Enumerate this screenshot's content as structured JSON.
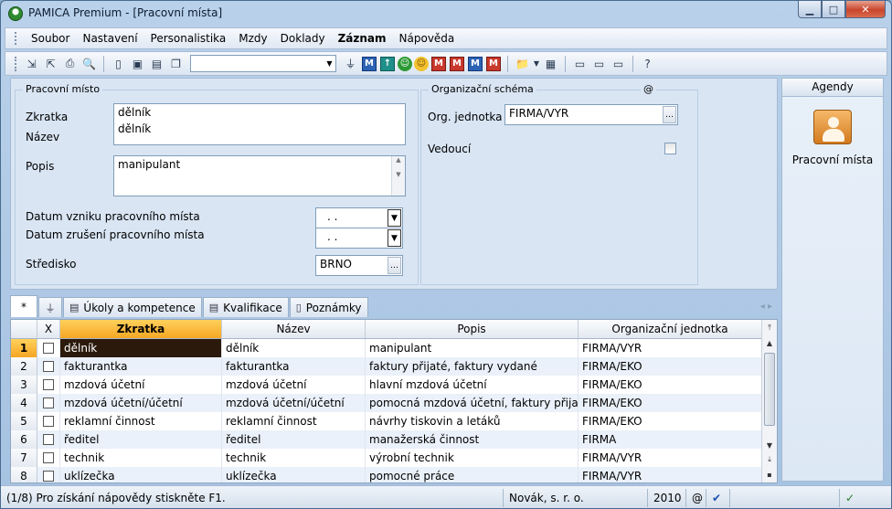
{
  "window": {
    "title": "PAMICA Premium - [Pracovní místa]",
    "minimize_glyph": "▁",
    "maximize_glyph": "□",
    "close_glyph": "✕"
  },
  "menu": [
    "Soubor",
    "Nastavení",
    "Personalistika",
    "Mzdy",
    "Doklady",
    "Záznam",
    "Nápověda"
  ],
  "toolbar": {
    "combo_value": "",
    "m_label": "M"
  },
  "form": {
    "group1_title": "Pracovní místo",
    "zkratka_label": "Zkratka",
    "zkratka_value": "dělník",
    "nazev_label": "Název",
    "nazev_value": "dělník",
    "popis_label": "Popis",
    "popis_value": "manipulant",
    "datum_vzniku_label": "Datum vzniku pracovního  místa",
    "datum_vzniku_value": ". .",
    "datum_zruseni_label": "Datum zrušení pracovního  místa",
    "datum_zruseni_value": ". .",
    "stredisko_label": "Středisko",
    "stredisko_value": "BRNO",
    "group2_title": "Organizační schéma",
    "group2_at": "@",
    "org_label": "Org. jednotka",
    "org_value": "FIRMA/VYR",
    "vedouci_label": "Vedoucí"
  },
  "agendy": {
    "header": "Agendy",
    "item_label": "Pracovní místa"
  },
  "tabs": {
    "star": "*",
    "items": [
      "Úkoly a kompetence",
      "Kvalifikace",
      "Poznámky"
    ]
  },
  "grid": {
    "columns": [
      "",
      "X",
      "Zkratka",
      "Název",
      "Popis",
      "Organizační jednotka"
    ],
    "rows": [
      {
        "num": "1",
        "zkratka": "dělník",
        "nazev": "dělník",
        "popis": "manipulant",
        "org": "FIRMA/VYR"
      },
      {
        "num": "2",
        "zkratka": "fakturantka",
        "nazev": "fakturantka",
        "popis": "faktury přijaté, faktury vydané",
        "org": "FIRMA/EKO"
      },
      {
        "num": "3",
        "zkratka": "mzdová účetní",
        "nazev": "mzdová účetní",
        "popis": "hlavní mzdová účetní",
        "org": "FIRMA/EKO"
      },
      {
        "num": "4",
        "zkratka": "mzdová účetní/účetní",
        "nazev": "mzdová účetní/účetní",
        "popis": "pomocná mzdová účetní, faktury přijaté",
        "org": "FIRMA/EKO"
      },
      {
        "num": "5",
        "zkratka": "reklamní činnost",
        "nazev": "reklamní činnost",
        "popis": "návrhy tiskovin a letáků",
        "org": "FIRMA/EKO"
      },
      {
        "num": "6",
        "zkratka": "ředitel",
        "nazev": "ředitel",
        "popis": "manažerská činnost",
        "org": "FIRMA"
      },
      {
        "num": "7",
        "zkratka": "technik",
        "nazev": "technik",
        "popis": "výrobní technik",
        "org": "FIRMA/VYR"
      },
      {
        "num": "8",
        "zkratka": "uklízečka",
        "nazev": "uklízečka",
        "popis": "pomocné práce",
        "org": "FIRMA/VYR"
      }
    ]
  },
  "status": {
    "help": "(1/8) Pro získání nápovědy stiskněte F1.",
    "company": "Novák, s. r. o.",
    "year": "2010",
    "at": "@"
  },
  "colors": {
    "accent": "#f5a623",
    "selected_cell": "#2b1a0c"
  }
}
